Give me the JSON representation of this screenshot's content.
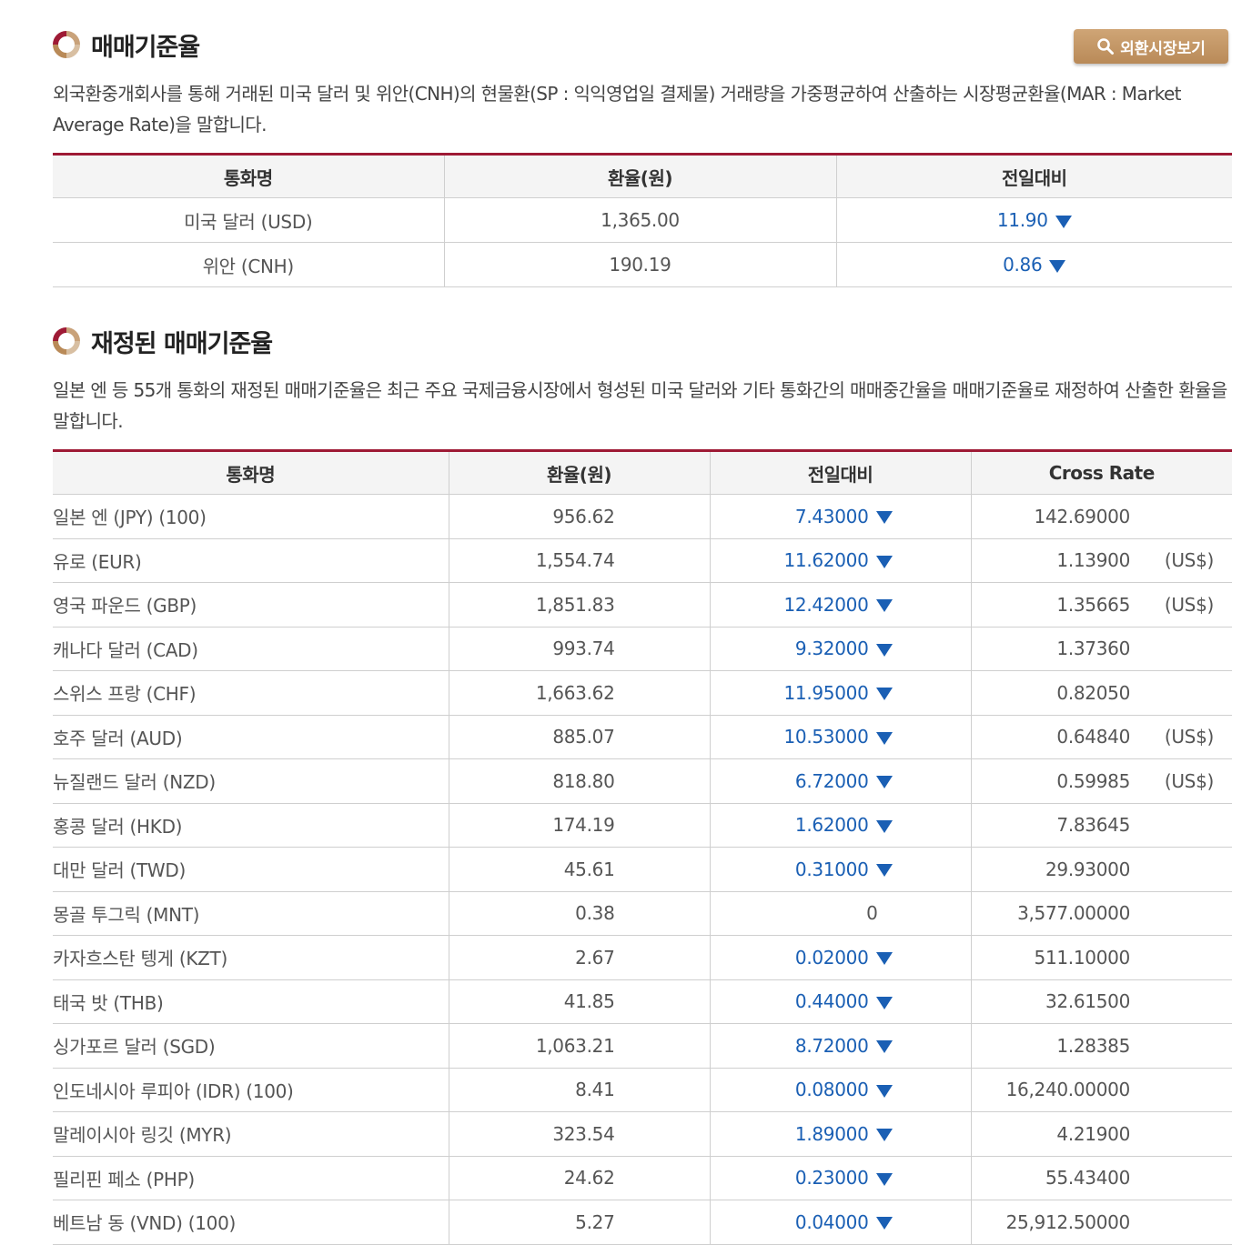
{
  "section1": {
    "title": "매매기준율",
    "button_label": "외환시장보기",
    "description": "외국환중개회사를 통해 거래된 미국 달러 및 위안(CNH)의 현물환(SP : 익익영업일 결제물) 거래량을 가중평균하여 산출하는 시장평균환율(MAR : Market Average Rate)을 말합니다.",
    "headers": [
      "통화명",
      "환율(원)",
      "전일대비"
    ],
    "rows": [
      {
        "name": "미국 달러 (USD)",
        "rate": "1,365.00",
        "change": "11.90",
        "direction": "down"
      },
      {
        "name": "위안 (CNH)",
        "rate": "190.19",
        "change": "0.86",
        "direction": "down"
      }
    ]
  },
  "section2": {
    "title": "재정된 매매기준율",
    "description": "일본 엔 등 55개 통화의 재정된 매매기준율은 최근 주요 국제금융시장에서 형성된 미국 달러와 기타 통화간의 매매중간율을 매매기준율로 재정하여 산출한 환율을 말합니다.",
    "headers": [
      "통화명",
      "환율(원)",
      "전일대비",
      "Cross Rate"
    ],
    "rows": [
      {
        "name": "일본 엔 (JPY) (100)",
        "rate": "956.62",
        "change": "7.43000",
        "direction": "down",
        "cross": "142.69000",
        "unit": ""
      },
      {
        "name": "유로 (EUR)",
        "rate": "1,554.74",
        "change": "11.62000",
        "direction": "down",
        "cross": "1.13900",
        "unit": "(US$)"
      },
      {
        "name": "영국 파운드 (GBP)",
        "rate": "1,851.83",
        "change": "12.42000",
        "direction": "down",
        "cross": "1.35665",
        "unit": "(US$)"
      },
      {
        "name": "캐나다 달러 (CAD)",
        "rate": "993.74",
        "change": "9.32000",
        "direction": "down",
        "cross": "1.37360",
        "unit": ""
      },
      {
        "name": "스위스 프랑 (CHF)",
        "rate": "1,663.62",
        "change": "11.95000",
        "direction": "down",
        "cross": "0.82050",
        "unit": ""
      },
      {
        "name": "호주 달러 (AUD)",
        "rate": "885.07",
        "change": "10.53000",
        "direction": "down",
        "cross": "0.64840",
        "unit": "(US$)"
      },
      {
        "name": "뉴질랜드 달러 (NZD)",
        "rate": "818.80",
        "change": "6.72000",
        "direction": "down",
        "cross": "0.59985",
        "unit": "(US$)"
      },
      {
        "name": "홍콩 달러 (HKD)",
        "rate": "174.19",
        "change": "1.62000",
        "direction": "down",
        "cross": "7.83645",
        "unit": ""
      },
      {
        "name": "대만 달러 (TWD)",
        "rate": "45.61",
        "change": "0.31000",
        "direction": "down",
        "cross": "29.93000",
        "unit": ""
      },
      {
        "name": "몽골 투그릭 (MNT)",
        "rate": "0.38",
        "change": "0",
        "direction": "none",
        "cross": "3,577.00000",
        "unit": ""
      },
      {
        "name": "카자흐스탄 텡게 (KZT)",
        "rate": "2.67",
        "change": "0.02000",
        "direction": "down",
        "cross": "511.10000",
        "unit": ""
      },
      {
        "name": "태국 밧 (THB)",
        "rate": "41.85",
        "change": "0.44000",
        "direction": "down",
        "cross": "32.61500",
        "unit": ""
      },
      {
        "name": "싱가포르 달러 (SGD)",
        "rate": "1,063.21",
        "change": "8.72000",
        "direction": "down",
        "cross": "1.28385",
        "unit": ""
      },
      {
        "name": "인도네시아 루피아 (IDR) (100)",
        "rate": "8.41",
        "change": "0.08000",
        "direction": "down",
        "cross": "16,240.00000",
        "unit": ""
      },
      {
        "name": "말레이시아 링깃 (MYR)",
        "rate": "323.54",
        "change": "1.89000",
        "direction": "down",
        "cross": "4.21900",
        "unit": ""
      },
      {
        "name": "필리핀 페소 (PHP)",
        "rate": "24.62",
        "change": "0.23000",
        "direction": "down",
        "cross": "55.43400",
        "unit": ""
      },
      {
        "name": "베트남 동 (VND) (100)",
        "rate": "5.27",
        "change": "0.04000",
        "direction": "down",
        "cross": "25,912.50000",
        "unit": ""
      }
    ]
  },
  "colors": {
    "accent": "#9e1a35",
    "down": "#1a5fb4",
    "button": "#c39a6b"
  },
  "icons": {
    "title": "ring-title-icon",
    "button": "search-icon",
    "down": "triangle-down-icon"
  }
}
